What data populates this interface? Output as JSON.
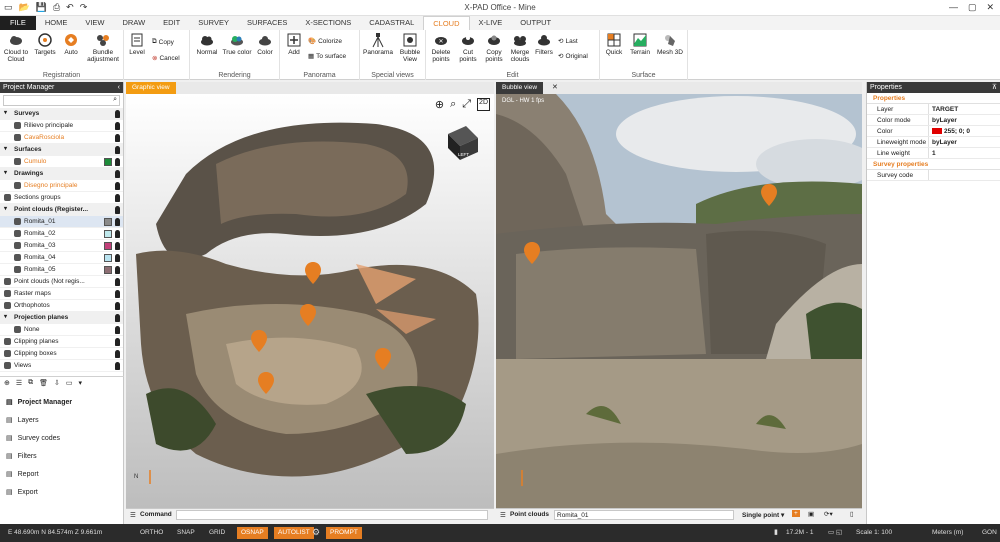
{
  "window": {
    "title": "X-PAD Office - Mine"
  },
  "ribbon_tabs": [
    {
      "label": "FILE",
      "kind": "file"
    },
    {
      "label": "HOME",
      "kind": ""
    },
    {
      "label": "VIEW",
      "kind": ""
    },
    {
      "label": "DRAW",
      "kind": ""
    },
    {
      "label": "EDIT",
      "kind": ""
    },
    {
      "label": "SURVEY",
      "kind": ""
    },
    {
      "label": "SURFACES",
      "kind": ""
    },
    {
      "label": "X-SECTIONS",
      "kind": ""
    },
    {
      "label": "CADASTRAL",
      "kind": ""
    },
    {
      "label": "CLOUD",
      "kind": "active"
    },
    {
      "label": "X-LIVE",
      "kind": ""
    },
    {
      "label": "OUTPUT",
      "kind": ""
    }
  ],
  "ribbon": {
    "registration": {
      "label": "Registration",
      "cloud_to_cloud": "Cloud to Cloud",
      "targets": "Targets",
      "auto": "Auto",
      "bundle": "Bundle adjustment"
    },
    "level": "Level",
    "copy": "Copy",
    "cancel": "Cancel",
    "rendering": {
      "label": "Rendering",
      "normal": "Normal",
      "true_color": "True color",
      "color": "Color"
    },
    "panorama_group": {
      "label": "Panorama",
      "add": "Add",
      "colorize": "Colorize",
      "to_surface": "To surface"
    },
    "special": {
      "label": "Special views",
      "panorama": "Panorama",
      "bubble": "Bubble View"
    },
    "edit": {
      "label": "Edit",
      "delete": "Delete points",
      "cut": "Cut points",
      "copy": "Copy points",
      "merge": "Merge clouds",
      "filters": "Filters",
      "last": "Last",
      "original": "Original"
    },
    "surface": {
      "label": "Surface",
      "quick": "Quick",
      "terrain": "Terrain",
      "mesh": "Mesh 3D"
    }
  },
  "project_manager": {
    "title": "Project Manager",
    "rows": [
      {
        "label": "Surveys",
        "kind": "header"
      },
      {
        "label": "Rilievo principale",
        "kind": "indent"
      },
      {
        "label": "CavaRosciola",
        "kind": "indent orange"
      },
      {
        "label": "Surfaces",
        "kind": "header"
      },
      {
        "label": "Cumulo",
        "kind": "indent orange",
        "swatch": "#1e8c3a"
      },
      {
        "label": "Drawings",
        "kind": "header"
      },
      {
        "label": "Disegno principale",
        "kind": "indent orange"
      },
      {
        "label": "Sections groups",
        "kind": ""
      },
      {
        "label": "Point clouds (Register...",
        "kind": "header"
      },
      {
        "label": "Romita_01",
        "kind": "indent selected",
        "swatch": "#8a8a8a"
      },
      {
        "label": "Romita_02",
        "kind": "indent",
        "swatch": "#bfe8ec"
      },
      {
        "label": "Romita_03",
        "kind": "indent",
        "swatch": "#c2407a"
      },
      {
        "label": "Romita_04",
        "kind": "indent",
        "swatch": "#b9e3f0"
      },
      {
        "label": "Romita_05",
        "kind": "indent",
        "swatch": "#8d6e73"
      },
      {
        "label": "Point clouds (Not regis...",
        "kind": ""
      },
      {
        "label": "Raster maps",
        "kind": ""
      },
      {
        "label": "Orthophotos",
        "kind": ""
      },
      {
        "label": "Projection planes",
        "kind": "header"
      },
      {
        "label": "None",
        "kind": "indent"
      },
      {
        "label": "Clipping planes",
        "kind": ""
      },
      {
        "label": "Clipping boxes",
        "kind": ""
      },
      {
        "label": "Views",
        "kind": ""
      }
    ],
    "nav": [
      {
        "label": "Project Manager",
        "bold": true
      },
      {
        "label": "Layers",
        "bold": false
      },
      {
        "label": "Survey codes",
        "bold": false
      },
      {
        "label": "Filters",
        "bold": false
      },
      {
        "label": "Report",
        "bold": false
      },
      {
        "label": "Export",
        "bold": false
      }
    ]
  },
  "graphic_view": {
    "tab": "Graphic view",
    "command_label": "Command",
    "twod": "2D",
    "cube_label": "LEFT"
  },
  "bubble_view": {
    "tab": "Bubble view",
    "overlay": "DGL - HW 1 fps",
    "point_clouds_label": "Point clouds",
    "cloud_value": "Romita_01",
    "single_point": "Single point"
  },
  "properties": {
    "title": "Properties",
    "section1": "Properties",
    "rows": [
      {
        "k": "Layer",
        "v": "TARGET",
        "swatch": ""
      },
      {
        "k": "Color mode",
        "v": "byLayer",
        "swatch": ""
      },
      {
        "k": "Color",
        "v": "255; 0; 0",
        "swatch": "#e00000"
      },
      {
        "k": "Lineweight mode",
        "v": "byLayer",
        "swatch": ""
      },
      {
        "k": "Line weight",
        "v": "1",
        "swatch": ""
      }
    ],
    "section2": "Survey properties",
    "rows2": [
      {
        "k": "Survey code",
        "v": ""
      }
    ]
  },
  "status": {
    "coords": "E 48.690m N 84.574m Z 9.661m",
    "toggles": [
      {
        "label": "ORTHO",
        "on": false
      },
      {
        "label": "SNAP",
        "on": false
      },
      {
        "label": "GRID",
        "on": false
      },
      {
        "label": "OSNAP",
        "on": true
      },
      {
        "label": "AUTOLIST",
        "on": true
      },
      {
        "label": "PROMPT",
        "on": true
      }
    ],
    "zoom": "17.2M - 1",
    "scale": "Scale 1: 100",
    "units": "Meters (m)",
    "angle": "GON"
  }
}
